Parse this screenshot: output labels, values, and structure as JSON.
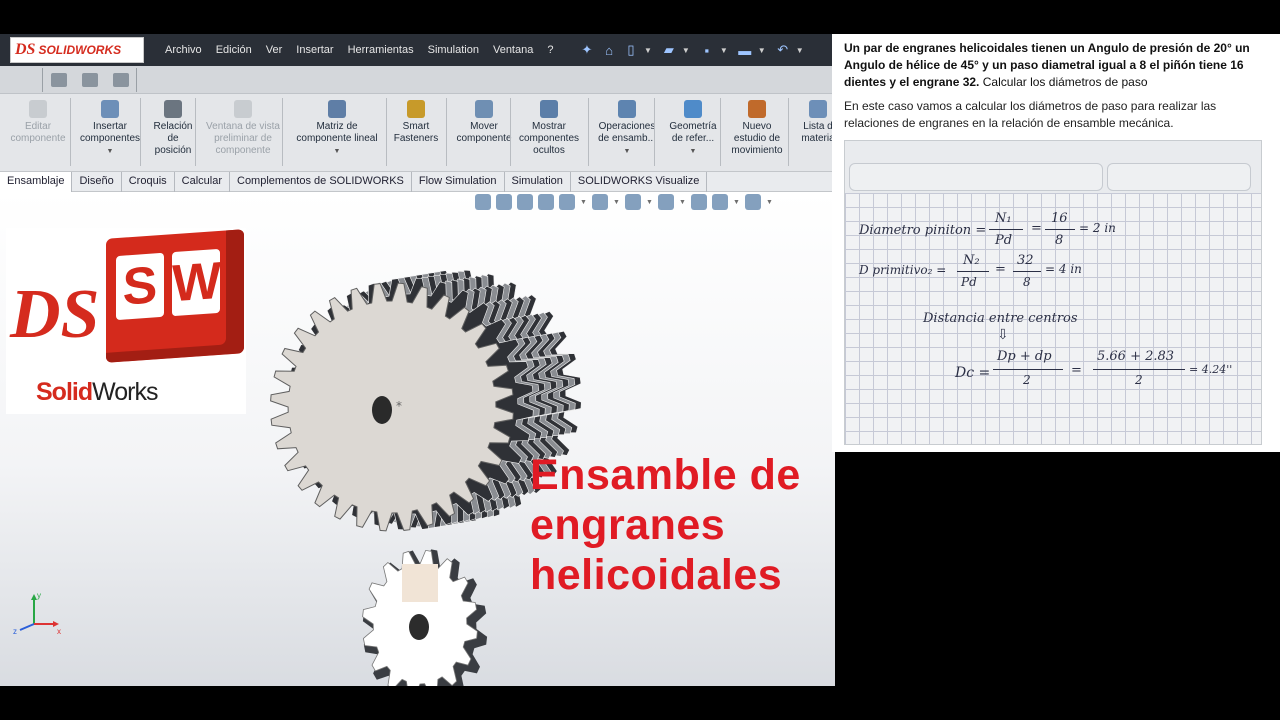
{
  "app": {
    "brand": "SOLIDWORKS",
    "menu": [
      "Archivo",
      "Edición",
      "Ver",
      "Insertar",
      "Herramientas",
      "Simulation",
      "Ventana",
      "?"
    ]
  },
  "commands": [
    {
      "label": "Editar componente",
      "enabled": false
    },
    {
      "label": "Insertar componentes",
      "enabled": true
    },
    {
      "label": "Relación de posición",
      "enabled": true
    },
    {
      "label": "Ventana de vista preliminar de componente",
      "enabled": false
    },
    {
      "label": "Matriz de componente lineal",
      "enabled": true
    },
    {
      "label": "Smart Fasteners",
      "enabled": true
    },
    {
      "label": "Mover componente",
      "enabled": true
    },
    {
      "label": "Mostrar componentes ocultos",
      "enabled": true
    },
    {
      "label": "Operaciones de ensamb...",
      "enabled": true
    },
    {
      "label": "Geometría de refer...",
      "enabled": true
    },
    {
      "label": "Nuevo estudio de movimiento",
      "enabled": true
    },
    {
      "label": "Lista d materia",
      "enabled": true
    }
  ],
  "tabs": [
    "Ensamblaje",
    "Diseño",
    "Croquis",
    "Calcular",
    "Complementos de SOLIDWORKS",
    "Flow Simulation",
    "Simulation",
    "SOLIDWORKS Visualize"
  ],
  "logo": {
    "mark_s": "S",
    "mark_w": "W",
    "ds": "DS",
    "word_a": "Solid",
    "word_b": "Works"
  },
  "overlay_title": [
    "Ensamble  de",
    "engranes",
    "helicoidales"
  ],
  "problem": {
    "statement_bold": "Un par de engranes helicoidales tienen un Angulo de presión de 20° un Angulo de hélice de 45° y un paso diametral igual a 8 el piñón tiene 16 dientes y el engrane 32.",
    "statement_rest": " Calcular los diámetros de paso",
    "explanation": "En este caso vamos a calcular los diámetros de paso para realizar las relaciones de engranes en la relación de ensamble mecánica."
  },
  "handwriting": {
    "line1_label": "Diametro piniton =",
    "line1_n": "N₁",
    "line1_d": "Pd",
    "line1_eq": "=",
    "line1_n2": "16",
    "line1_d2": "8",
    "line1_res": "= 2 in",
    "line2_label": "D primitivo₂ =",
    "line2_n": "N₂",
    "line2_d": "Pd",
    "line2_eq": "=",
    "line2_n2": "32",
    "line2_d2": "8",
    "line2_res": "= 4 in",
    "line3": "Distancia  entre  centros",
    "line4_label": "Dc =",
    "line4_n": "Dp + dp",
    "line4_d": "2",
    "line4_eq": "=",
    "line4_n2": "5.66 + 2.83",
    "line4_d2": "2",
    "line4_res": "= 4.24''"
  },
  "colors": {
    "accent_red": "#e01b24",
    "menubar": "#2a2f37",
    "solidworks_red": "#d52b1e"
  },
  "gear_large": {
    "teeth": 32
  },
  "gear_small": {
    "teeth": 16
  }
}
